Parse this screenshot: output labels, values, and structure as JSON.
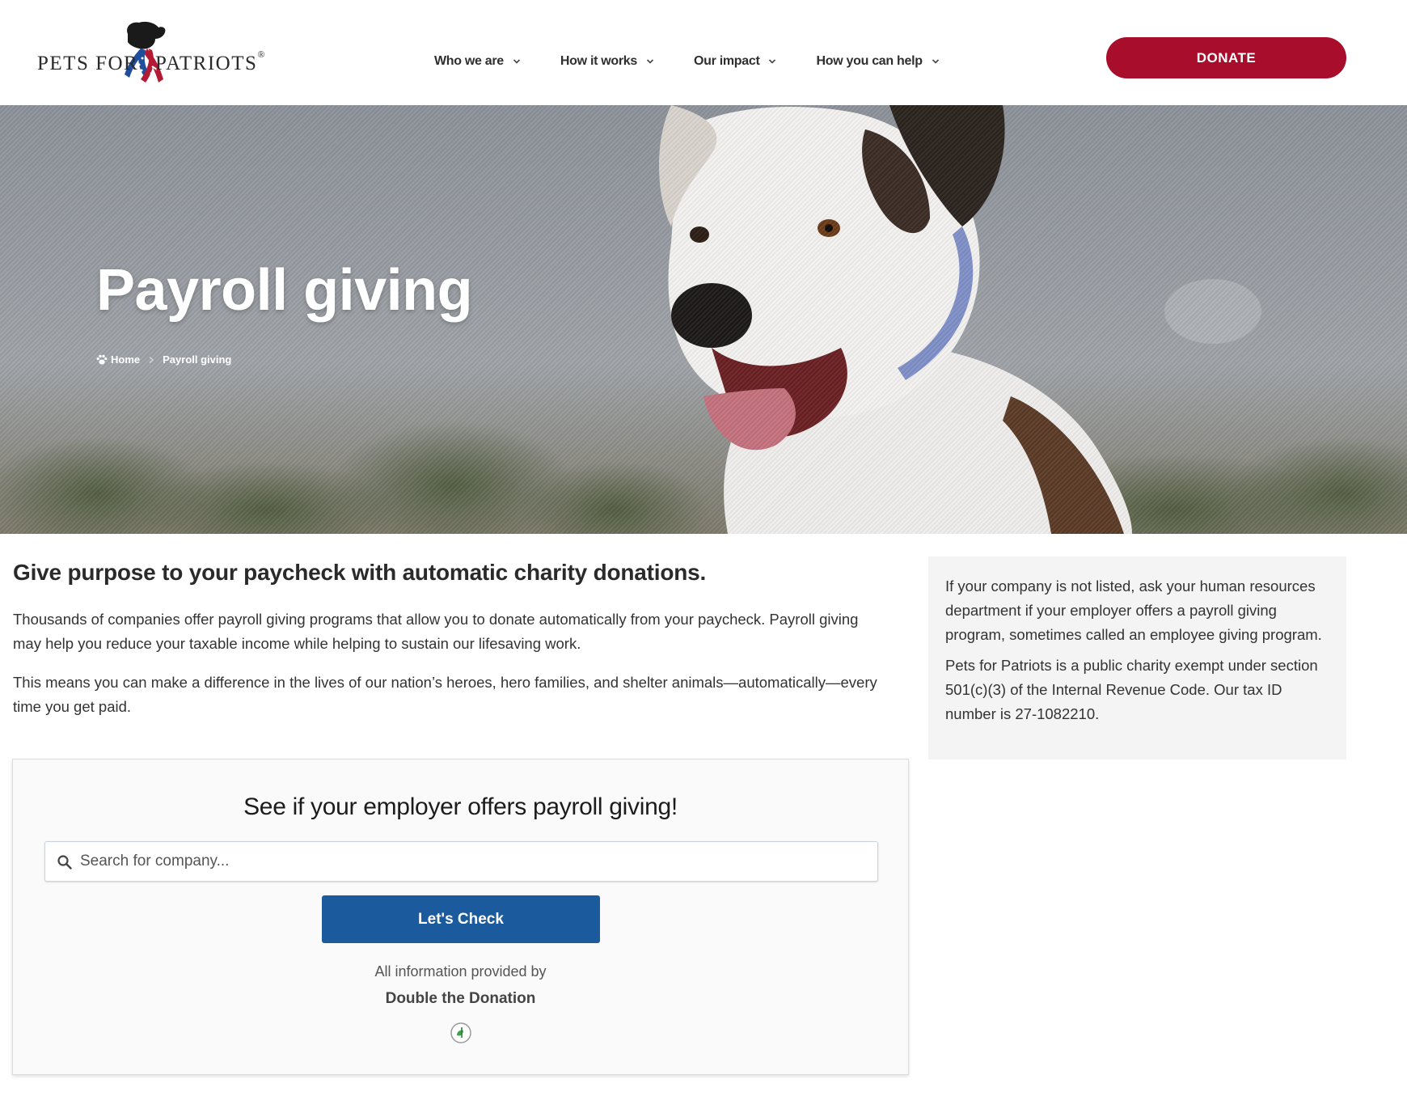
{
  "header": {
    "logo": {
      "left_text": "PETS FOR",
      "right_text": "PATRIOTS",
      "registered": "®"
    },
    "nav": [
      {
        "label": "Who we are"
      },
      {
        "label": "How it works"
      },
      {
        "label": "Our impact"
      },
      {
        "label": "How you can help"
      }
    ],
    "donate_label": "DONATE"
  },
  "hero": {
    "title": "Payroll giving",
    "breadcrumb": {
      "home": "Home",
      "current": "Payroll giving"
    }
  },
  "main": {
    "heading": "Give purpose to your paycheck with automatic charity donations.",
    "paragraphs": [
      "Thousands of companies offer payroll giving programs that allow you to donate automatically from your paycheck. Payroll giving may help you reduce your taxable income while helping to sustain our lifesaving work.",
      "This means you can make a difference in the lives of our nation’s heroes, hero families, and shelter animals—automatically—every time you get paid."
    ]
  },
  "aside": {
    "paragraphs": [
      "If your company is not listed, ask your human resources department if your employer offers a payroll giving program, sometimes called an employee giving program.",
      "Pets for Patriots is a public charity exempt under section 501(c)(3) of the Internal Revenue Code. Our tax ID number is 27-1082210."
    ]
  },
  "widget": {
    "title": "See if your employer offers payroll giving!",
    "search": {
      "placeholder": "Search for company...",
      "value": ""
    },
    "button_label": "Let's Check",
    "provided_text": "All information provided by",
    "provider_name": "Double the Donation"
  },
  "colors": {
    "donate": "#a80d2c",
    "check_button": "#1b5a9c",
    "aside_bg": "#f4f4f4"
  }
}
